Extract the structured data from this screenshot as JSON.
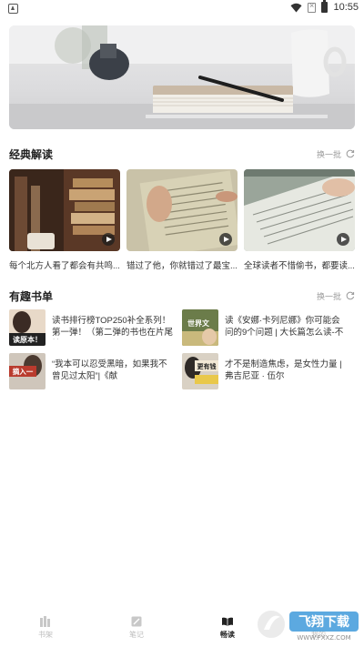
{
  "status_bar": {
    "time": "10:55"
  },
  "classic": {
    "title": "经典解读",
    "refresh_label": "换一批",
    "videos": [
      {
        "caption": "每个北方人看了都会有共鸣..."
      },
      {
        "caption": "错过了他，你就错过了最宝..."
      },
      {
        "caption": "全球读者不惜偷书，都要读..."
      }
    ]
  },
  "booklists": {
    "title": "有趣书单",
    "refresh_label": "换一批",
    "items": [
      {
        "text": "读书排行榜TOP250补全系列！第一弹！（第二弹的书也在片尾抽...",
        "cover_text": "读原本！"
      },
      {
        "text": "读《安娜·卡列尼娜》你可能会问的9个问题 | 大长篇怎么读-不同...",
        "cover_text": "世界文"
      },
      {
        "text": "“我本可以忍受黑暗，如果我不曾见过太阳”|《献",
        "cover_text": "摘入一"
      },
      {
        "text": "才不是制造焦虑，是女性力量 |弗吉尼亚 · 伍尔",
        "cover_text": "更有钱"
      }
    ]
  },
  "bottom_nav": {
    "items": [
      {
        "label": "书架"
      },
      {
        "label": "笔记"
      },
      {
        "label": "畅读"
      },
      {
        "label": "我的"
      }
    ],
    "active_index": 2
  },
  "watermark": {
    "text": "飞翔下载",
    "url_text": "WWW.FXXZ.COM"
  }
}
